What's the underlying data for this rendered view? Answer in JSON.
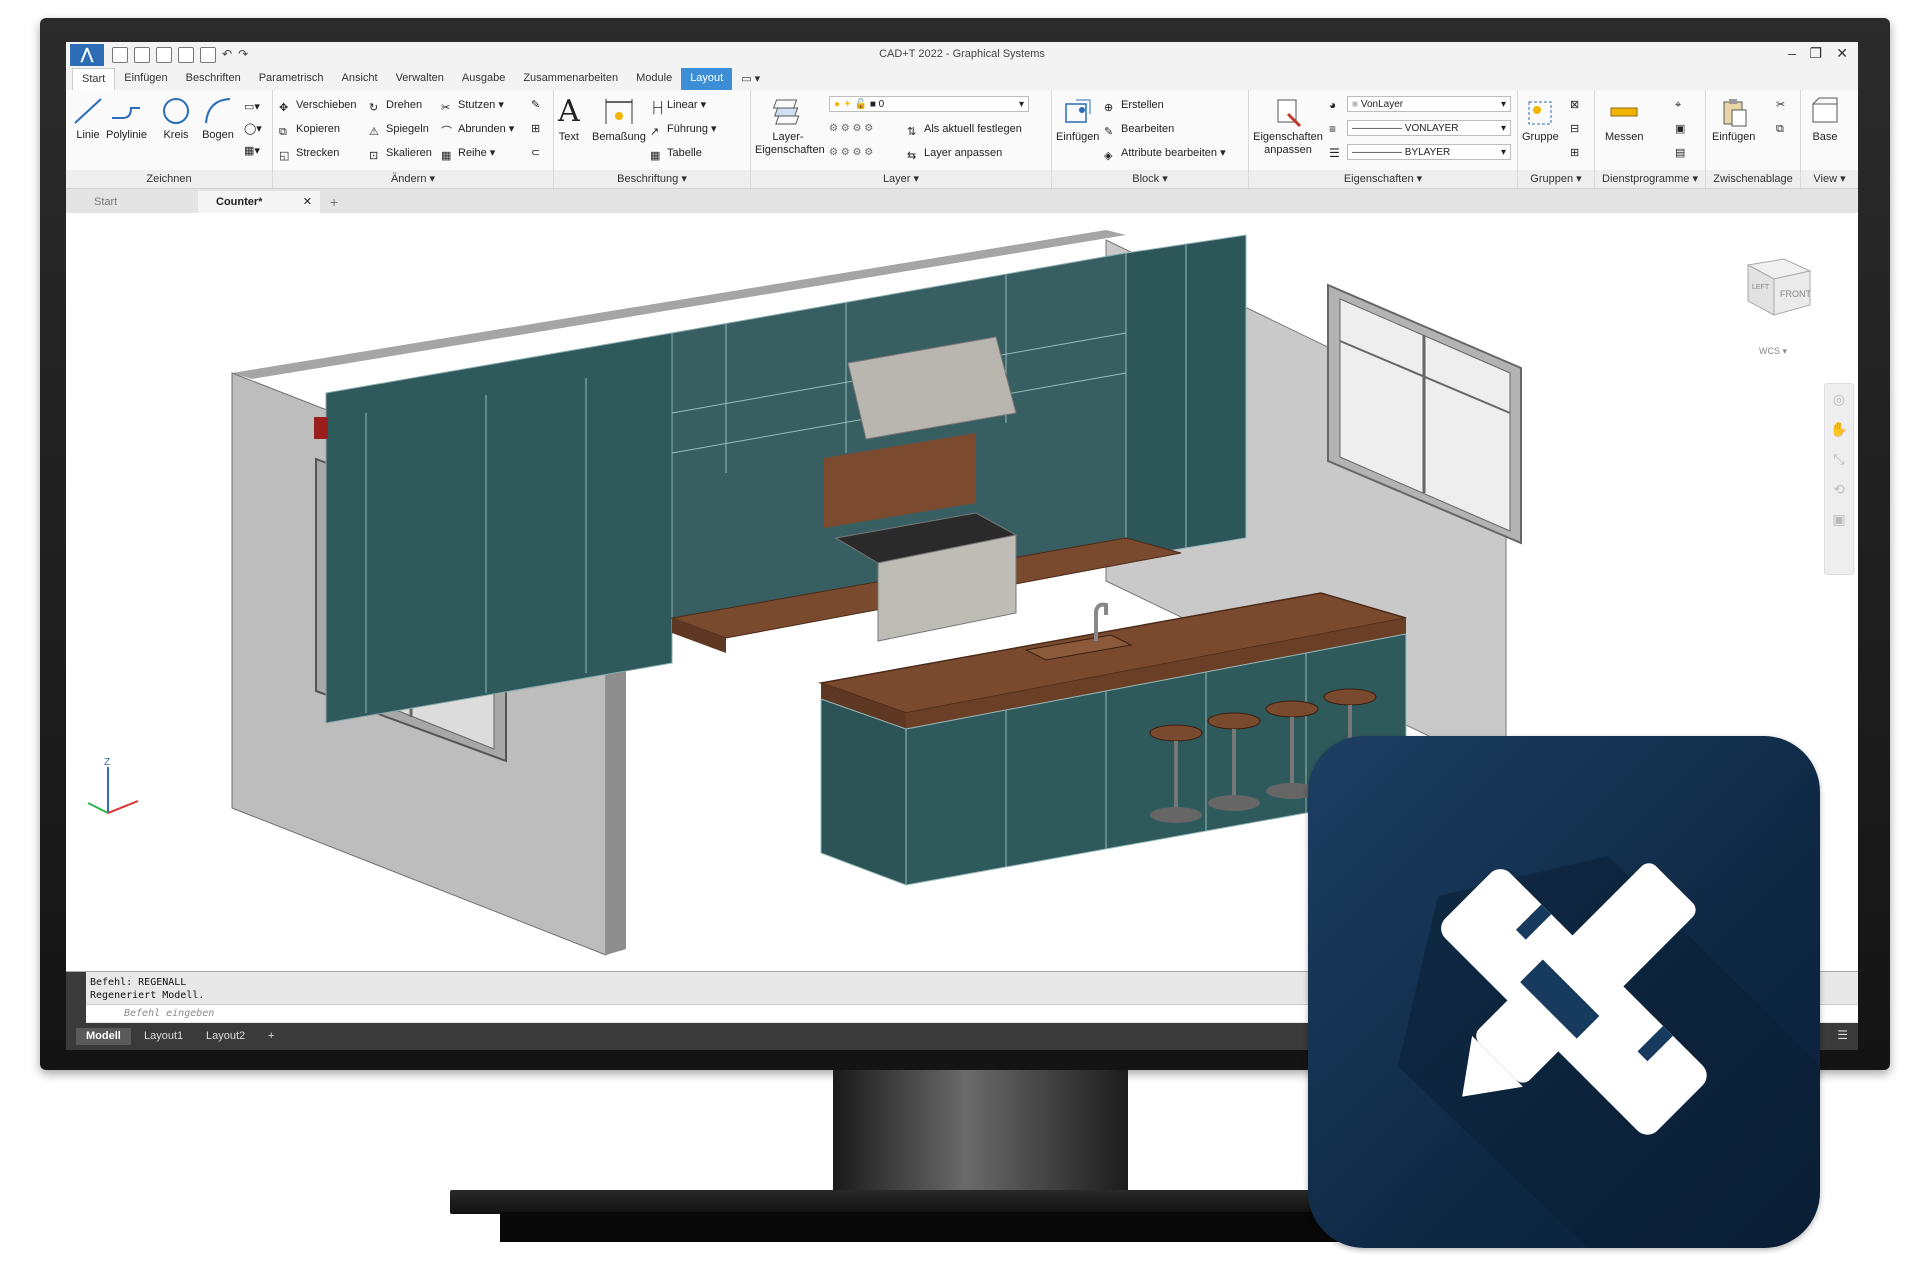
{
  "window": {
    "title": "CAD+T 2022 - Graphical Systems"
  },
  "ribbon_tabs": [
    "Start",
    "Einfügen",
    "Beschriften",
    "Parametrisch",
    "Ansicht",
    "Verwalten",
    "Ausgabe",
    "Zusammenarbeiten",
    "Module",
    "Layout"
  ],
  "panels": {
    "zeichnen": {
      "title": "Zeichnen",
      "linie": "Linie",
      "polylinie": "Polylinie",
      "kreis": "Kreis",
      "bogen": "Bogen"
    },
    "aendern": {
      "title": "Ändern",
      "verschieben": "Verschieben",
      "drehen": "Drehen",
      "stutzen": "Stutzen",
      "kopieren": "Kopieren",
      "spiegeln": "Spiegeln",
      "abrunden": "Abrunden",
      "strecken": "Strecken",
      "skalieren": "Skalieren",
      "reihe": "Reihe"
    },
    "beschriftung": {
      "title": "Beschriftung",
      "text": "Text",
      "bemassung": "Bemaßung",
      "linear": "Linear",
      "fuehrung": "Führung",
      "tabelle": "Tabelle"
    },
    "layer": {
      "title": "Layer",
      "layer_eigenschaften": "Layer-\nEigenschaften",
      "current_layer": "0",
      "als_aktuell": "Als aktuell festlegen",
      "layer_anpassen": "Layer anpassen"
    },
    "block": {
      "title": "Block",
      "einfuegen": "Einfügen",
      "erstellen": "Erstellen",
      "bearbeiten": "Bearbeiten",
      "attribute": "Attribute bearbeiten"
    },
    "eigenschaften": {
      "title": "Eigenschaften",
      "anpassen": "Eigenschaften\nanpassen",
      "color": "VonLayer",
      "linetype": "VONLAYER",
      "lineweight": "BYLAYER"
    },
    "gruppen": {
      "title": "Gruppen",
      "gruppe": "Gruppe"
    },
    "dienst": {
      "title": "Dienstprogramme",
      "messen": "Messen"
    },
    "zwischenablage": {
      "title": "Zwischenablage",
      "einfuegen": "Einfügen"
    },
    "view": {
      "title": "View",
      "base": "Base"
    }
  },
  "doc_tabs": [
    "Start",
    "Counter*"
  ],
  "viewcube": {
    "face": "FRONT",
    "side": "LEFT",
    "wcs": "WCS"
  },
  "command": {
    "line1": "Befehl: REGENALL",
    "line2": "Regeneriert Modell.",
    "placeholder": "Befehl eingeben"
  },
  "layout_tabs": [
    "Modell",
    "Layout1",
    "Layout2"
  ],
  "colors": {
    "accent": "#3d8ed6",
    "cabinet": "#2f5a5c",
    "counter": "#7a4a2e",
    "brand": "#163a5c"
  }
}
